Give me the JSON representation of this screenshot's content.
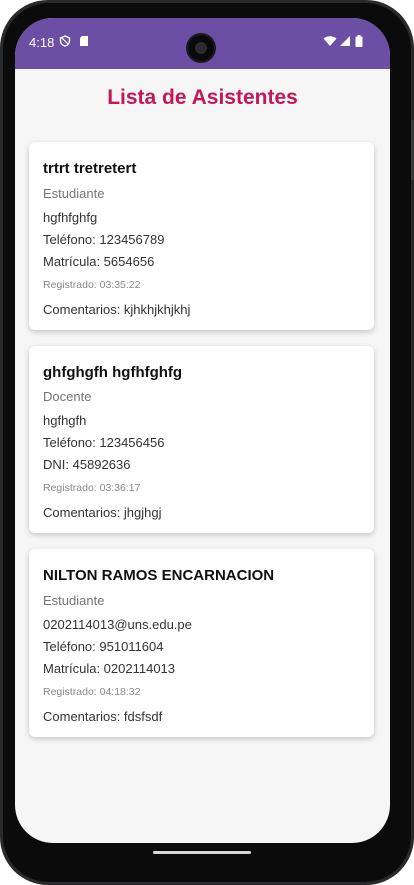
{
  "status_bar": {
    "time": "4:18"
  },
  "page": {
    "title": "Lista de Asistentes"
  },
  "attendees": [
    {
      "name": "trtrt tretretert",
      "role": "Estudiante",
      "email": "hgfhfghfg",
      "phone": "Teléfono: 123456789",
      "id_line": "Matrícula: 5654656",
      "registered": "Registrado: 03:35:22",
      "comments": "Comentarios: kjhkhjkhjkhj"
    },
    {
      "name": "ghfghgfh hgfhfghfg",
      "role": "Docente",
      "email": "hgfhgfh",
      "phone": "Teléfono: 123456456",
      "id_line": "DNI: 45892636",
      "registered": "Registrado: 03:36:17",
      "comments": "Comentarios: jhgjhgj"
    },
    {
      "name": "NILTON RAMOS ENCARNACION",
      "role": "Estudiante",
      "email": "0202114013@uns.edu.pe",
      "phone": "Teléfono: 951011604",
      "id_line": "Matrícula: 0202114013",
      "registered": "Registrado: 04:18:32",
      "comments": "Comentarios: fdsfsdf"
    }
  ],
  "colors": {
    "status_bar": "#6a4fa4",
    "title": "#c2185b",
    "background": "#f6f6f6"
  },
  "icons": [
    "shield-icon",
    "sd-card-icon",
    "wifi-icon",
    "signal-icon",
    "battery-icon"
  ]
}
